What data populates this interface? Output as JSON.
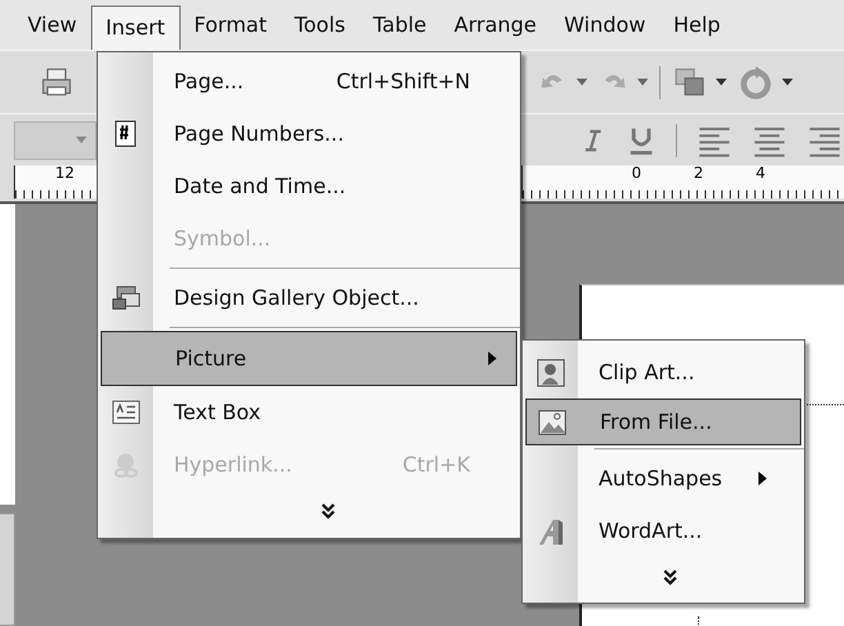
{
  "menubar": [
    {
      "label": "View",
      "selected": false
    },
    {
      "label": "Insert",
      "selected": true
    },
    {
      "label": "Format",
      "selected": false
    },
    {
      "label": "Tools",
      "selected": false
    },
    {
      "label": "Table",
      "selected": false
    },
    {
      "label": "Arrange",
      "selected": false
    },
    {
      "label": "Window",
      "selected": false
    },
    {
      "label": "Help",
      "selected": false
    }
  ],
  "ruler": {
    "left_labels": [
      "12"
    ],
    "right_labels": [
      "0",
      "2",
      "4"
    ]
  },
  "insert_menu": {
    "items": [
      {
        "kind": "item",
        "label": "Page...",
        "shortcut": "Ctrl+Shift+N",
        "disabled": false,
        "selected": false,
        "submenu": false
      },
      {
        "kind": "item",
        "label": "Page Numbers...",
        "disabled": false,
        "selected": false,
        "submenu": false
      },
      {
        "kind": "item",
        "label": "Date and Time...",
        "disabled": false,
        "selected": false,
        "submenu": false
      },
      {
        "kind": "item",
        "label": "Symbol...",
        "disabled": true,
        "selected": false,
        "submenu": false
      },
      {
        "kind": "separator"
      },
      {
        "kind": "item",
        "label": "Design Gallery Object...",
        "disabled": false,
        "selected": false,
        "submenu": false
      },
      {
        "kind": "separator"
      },
      {
        "kind": "item",
        "label": "Picture",
        "disabled": false,
        "selected": true,
        "submenu": true
      },
      {
        "kind": "item",
        "label": "Text Box",
        "disabled": false,
        "selected": false,
        "submenu": false
      },
      {
        "kind": "item",
        "label": "Hyperlink...",
        "shortcut": "Ctrl+K",
        "disabled": true,
        "selected": false,
        "submenu": false
      },
      {
        "kind": "more"
      }
    ]
  },
  "picture_submenu": {
    "items": [
      {
        "kind": "item",
        "label": "Clip Art...",
        "disabled": false,
        "selected": false,
        "submenu": false
      },
      {
        "kind": "item",
        "label": "From File...",
        "disabled": false,
        "selected": true,
        "submenu": false
      },
      {
        "kind": "separator"
      },
      {
        "kind": "item",
        "label": "AutoShapes",
        "disabled": false,
        "selected": false,
        "submenu": true
      },
      {
        "kind": "item",
        "label": "WordArt...",
        "disabled": false,
        "selected": false,
        "submenu": false
      },
      {
        "kind": "more"
      }
    ]
  }
}
